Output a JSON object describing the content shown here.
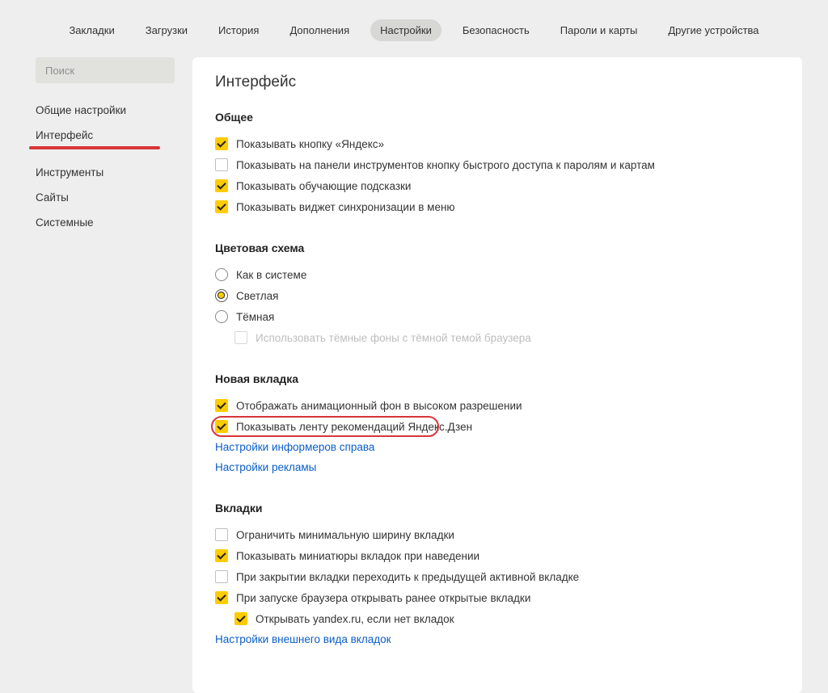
{
  "topnav": {
    "items": [
      {
        "label": "Закладки"
      },
      {
        "label": "Загрузки"
      },
      {
        "label": "История"
      },
      {
        "label": "Дополнения"
      },
      {
        "label": "Настройки",
        "active": true
      },
      {
        "label": "Безопасность"
      },
      {
        "label": "Пароли и карты"
      },
      {
        "label": "Другие устройства"
      }
    ]
  },
  "sidebar": {
    "search_placeholder": "Поиск",
    "items": [
      {
        "label": "Общие настройки"
      },
      {
        "label": "Интерфейс",
        "highlighted": true
      },
      {
        "label": "Инструменты"
      },
      {
        "label": "Сайты"
      },
      {
        "label": "Системные"
      }
    ]
  },
  "content": {
    "title": "Интерфейс",
    "general": {
      "heading": "Общее",
      "show_yandex_button": {
        "label": "Показывать кнопку «Яндекс»",
        "checked": true
      },
      "show_password_button": {
        "label": "Показывать на панели инструментов кнопку быстрого доступа к паролям и картам",
        "checked": false
      },
      "show_tips": {
        "label": "Показывать обучающие подсказки",
        "checked": true
      },
      "show_sync_widget": {
        "label": "Показывать виджет синхронизации в меню",
        "checked": true
      }
    },
    "color_scheme": {
      "heading": "Цветовая схема",
      "system": {
        "label": "Как в системе"
      },
      "light": {
        "label": "Светлая",
        "selected": true
      },
      "dark": {
        "label": "Тёмная"
      },
      "use_dark_backgrounds": {
        "label": "Использовать тёмные фоны с тёмной темой браузера",
        "checked": false,
        "disabled": true
      }
    },
    "new_tab": {
      "heading": "Новая вкладка",
      "hd_background": {
        "label": "Отображать анимационный фон в высоком разрешении",
        "checked": true
      },
      "show_zen": {
        "label": "Показывать ленту рекомендаций Яндекс.Дзен",
        "checked": true,
        "highlighted": true
      },
      "informer_settings_link": "Настройки информеров справа",
      "ads_settings_link": "Настройки рекламы"
    },
    "tabs": {
      "heading": "Вкладки",
      "limit_width": {
        "label": "Ограничить минимальную ширину вкладки",
        "checked": false
      },
      "show_thumbs": {
        "label": "Показывать миниатюры вкладок при наведении",
        "checked": true
      },
      "prev_active": {
        "label": "При закрытии вкладки переходить к предыдущей активной вкладке",
        "checked": false
      },
      "restore_tabs": {
        "label": "При запуске браузера открывать ранее открытые вкладки",
        "checked": true
      },
      "open_yandex": {
        "label": "Открывать yandex.ru, если нет вкладок",
        "checked": true
      },
      "appearance_link": "Настройки внешнего вида вкладок"
    }
  }
}
